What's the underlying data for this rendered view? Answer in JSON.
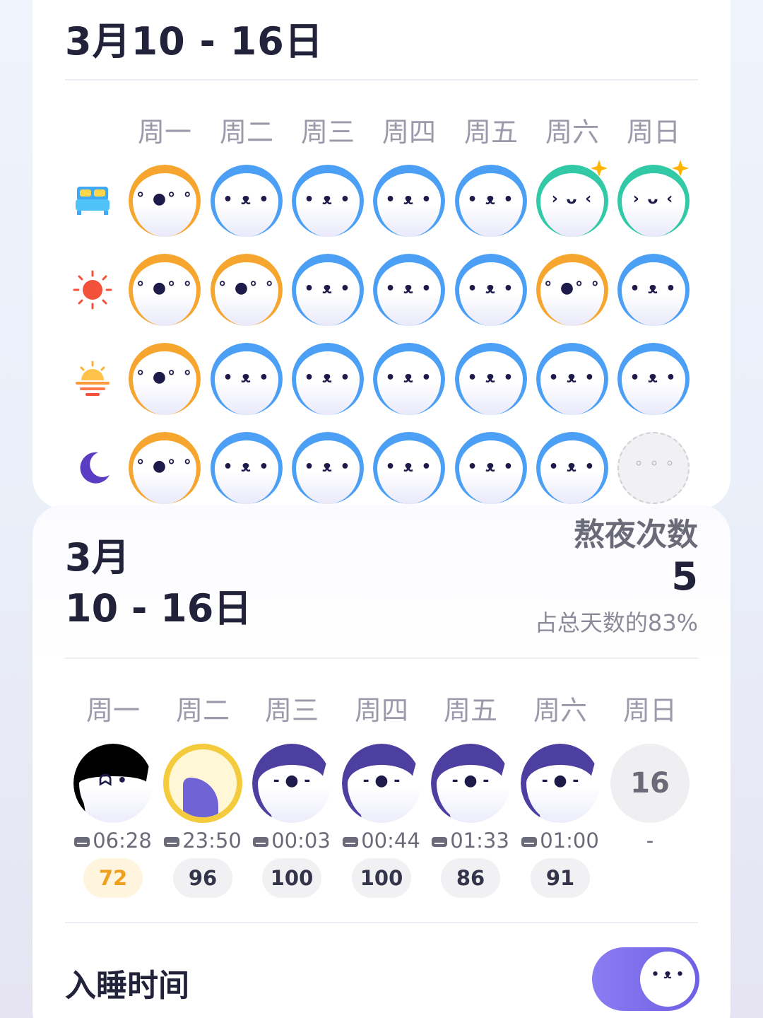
{
  "week_card": {
    "title": "3月10 - 16日",
    "days": [
      "周一",
      "周二",
      "周三",
      "周四",
      "周五",
      "周六",
      "周日"
    ],
    "rows": [
      {
        "icon": "bed-icon",
        "faces": [
          "orange",
          "blue",
          "blue",
          "blue",
          "blue",
          "teal-star",
          "teal-star"
        ]
      },
      {
        "icon": "sun-icon",
        "faces": [
          "orange",
          "orange",
          "blue",
          "blue",
          "blue",
          "orange",
          "blue"
        ]
      },
      {
        "icon": "sunset-icon",
        "faces": [
          "orange",
          "blue",
          "blue",
          "blue",
          "blue",
          "blue",
          "blue"
        ]
      },
      {
        "icon": "moon-icon",
        "faces": [
          "orange",
          "blue",
          "blue",
          "blue",
          "blue",
          "blue",
          "empty"
        ]
      }
    ]
  },
  "stay_up_card": {
    "month": "3月",
    "range": "10 - 16日",
    "stat_title": "熬夜次数",
    "stat_value": "5",
    "stat_sub": "占总天数的83%",
    "days": [
      "周一",
      "周二",
      "周三",
      "周四",
      "周五",
      "周六",
      "周日"
    ],
    "entries": [
      {
        "face": "ghost",
        "time": "06:28",
        "score": "72",
        "warn": true
      },
      {
        "face": "gold",
        "time": "23:50",
        "score": "96"
      },
      {
        "face": "sleepy",
        "time": "00:03",
        "score": "100"
      },
      {
        "face": "sleepy",
        "time": "00:44",
        "score": "100"
      },
      {
        "face": "sleepy",
        "time": "01:33",
        "score": "86"
      },
      {
        "face": "sleepy",
        "time": "01:00",
        "score": "91"
      },
      {
        "face": "number",
        "number": "16",
        "time": "-",
        "score": ""
      }
    ],
    "section_label": "入睡时间"
  },
  "colors": {
    "blue": "#4b9ff5",
    "orange": "#f6a62e",
    "teal": "#31c9a6",
    "purple": "#6e5fe4"
  }
}
